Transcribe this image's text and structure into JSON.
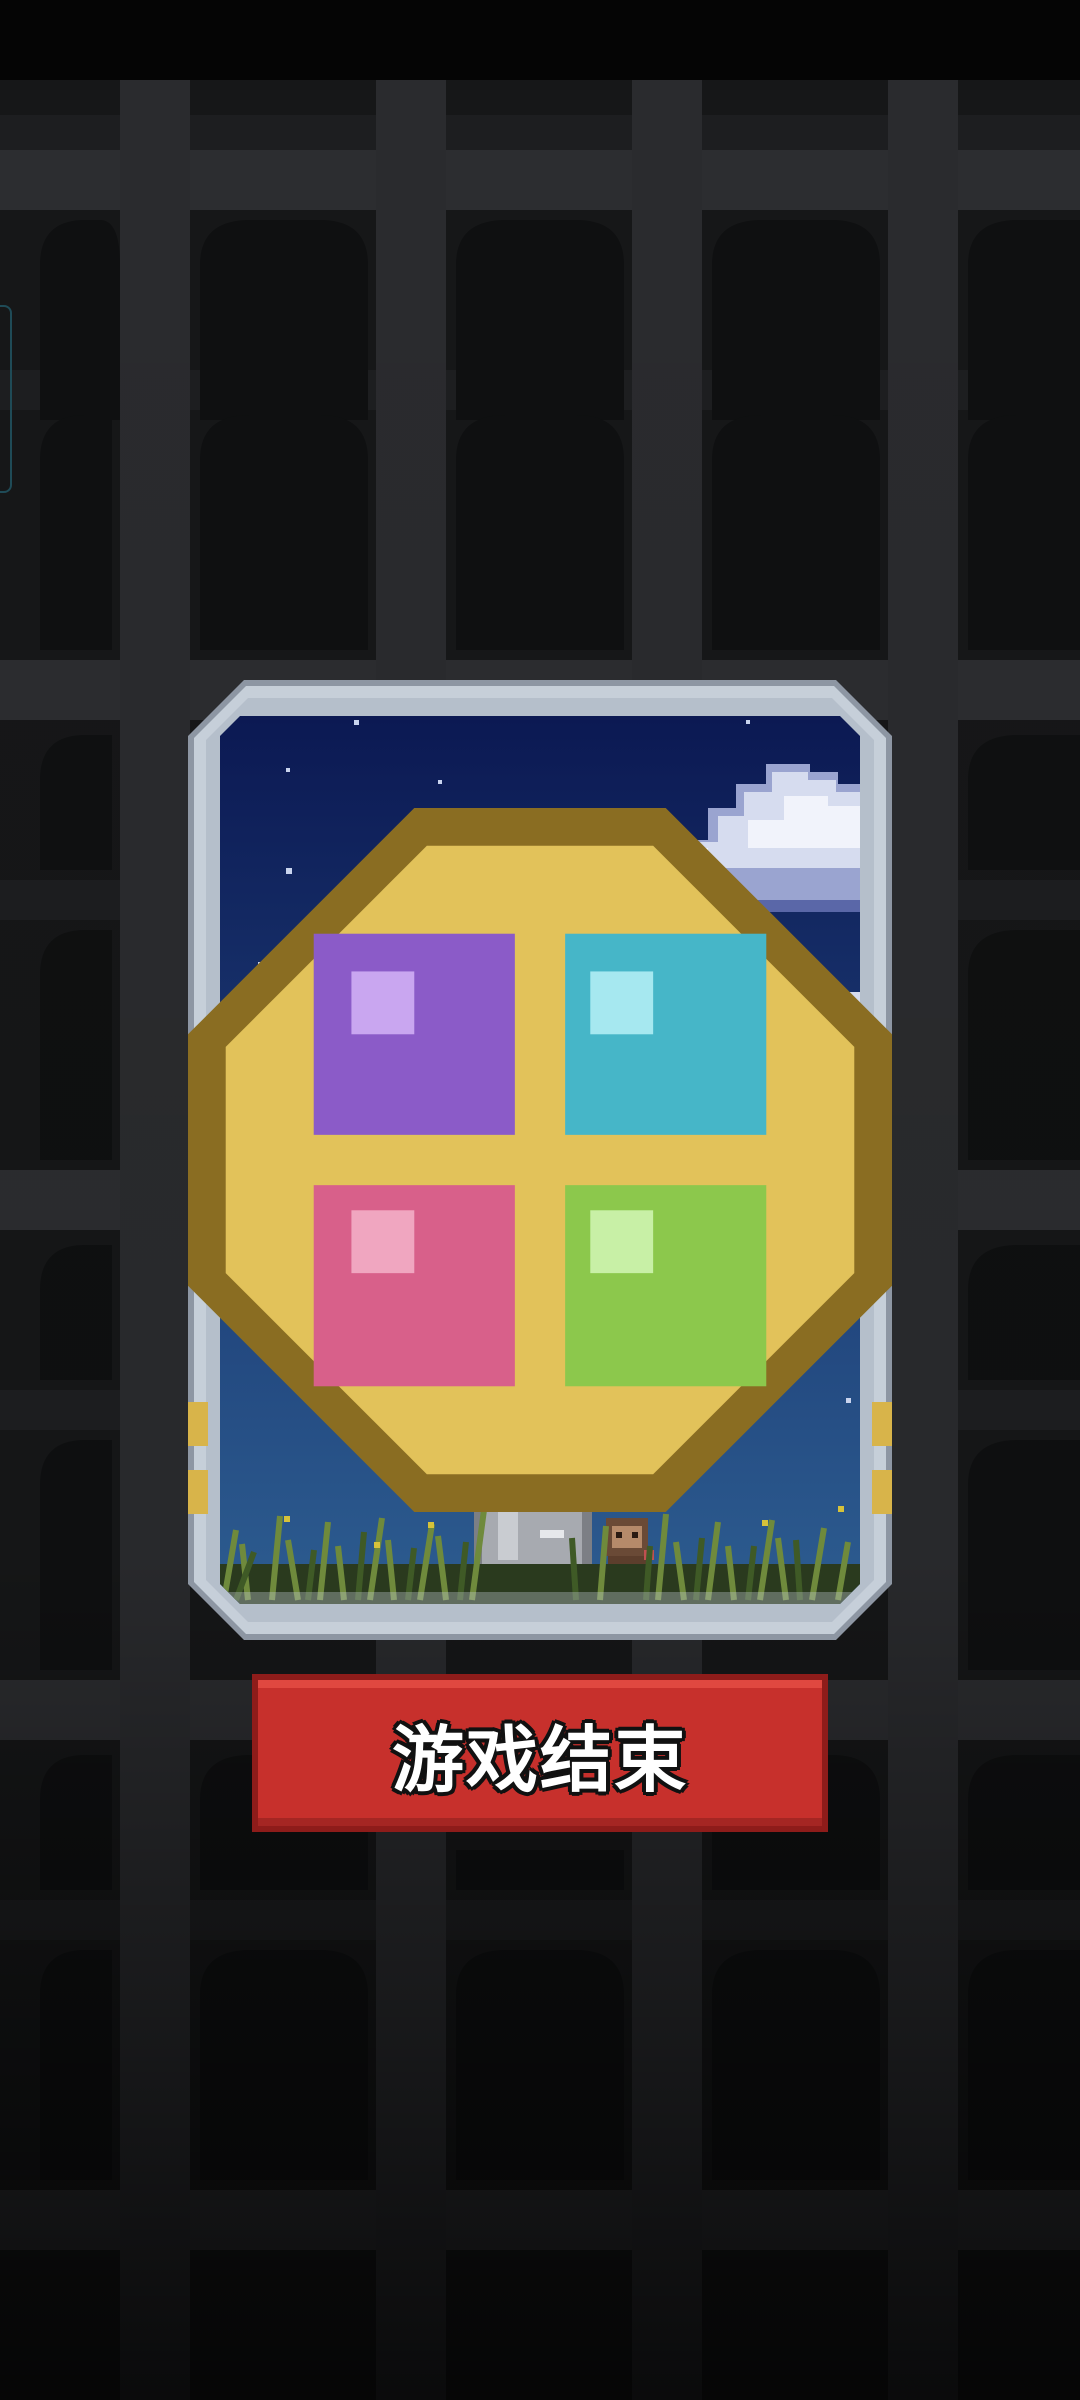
{
  "screen": {
    "title": "game-over-screen",
    "background_color": "#0c0c0d",
    "wall_color": "#2c2d30"
  },
  "card": {
    "frame_color": "#c6cfd9",
    "sky_top_color": "#0a1650",
    "sky_bottom_color": "#2e5f92",
    "grass_color": "#3d4f2a",
    "medallion_icon": "four-gem-medallion-icon",
    "character_icon": "masked-hero-icon",
    "pet_icon": "small-monkey-icon"
  },
  "game_over": {
    "label": "游戏结束",
    "button_color": "#c7302c"
  }
}
